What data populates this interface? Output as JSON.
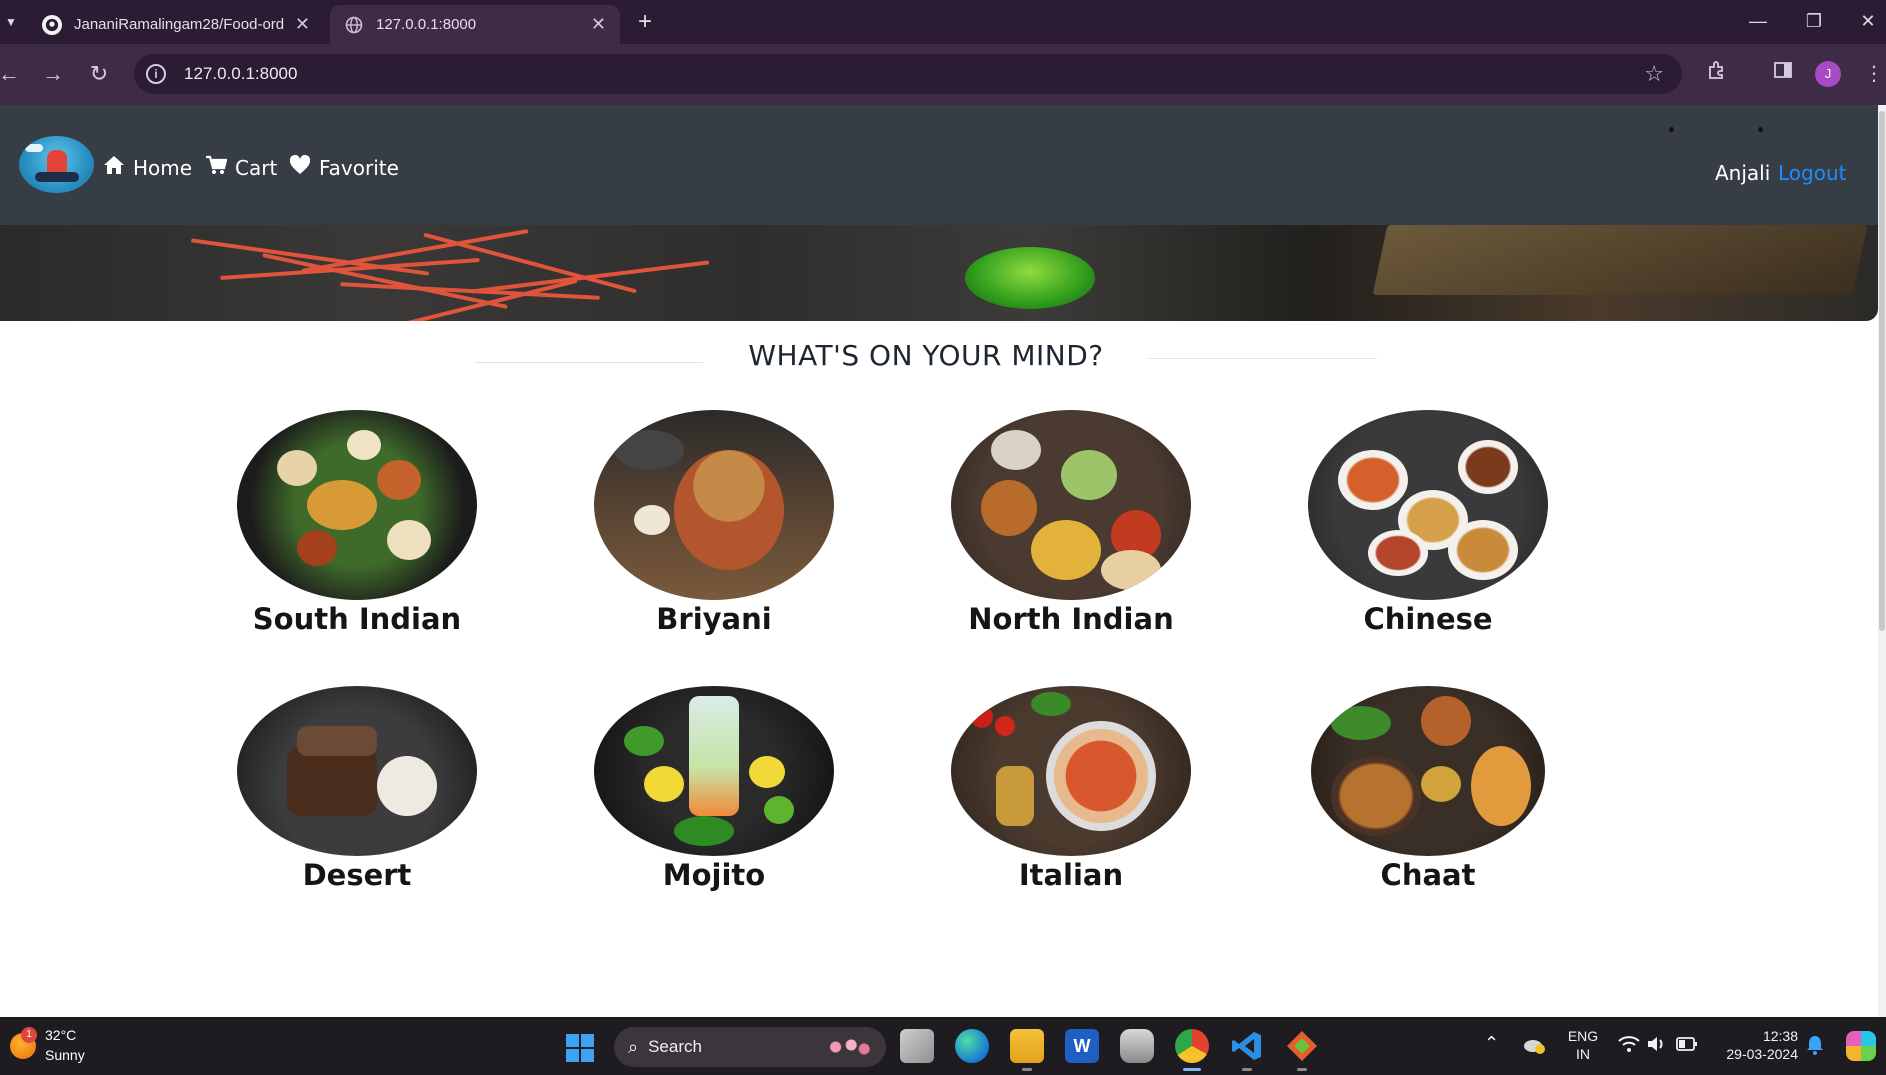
{
  "browser": {
    "tabs": [
      {
        "title": "JananiRamalingam28/Food-ord",
        "active": false
      },
      {
        "title": "127.0.0.1:8000",
        "active": true
      }
    ],
    "url": "127.0.0.1:8000",
    "profile_initial": "J"
  },
  "navbar": {
    "links": [
      {
        "label": "Home",
        "icon": "home-icon"
      },
      {
        "label": "Cart",
        "icon": "cart-icon"
      },
      {
        "label": "Favorite",
        "icon": "heart-icon"
      }
    ],
    "user": "Anjali",
    "logout": "Logout"
  },
  "heading": "WHAT'S ON YOUR MIND?",
  "categories": [
    {
      "label": "South Indian"
    },
    {
      "label": "Briyani"
    },
    {
      "label": "North Indian"
    },
    {
      "label": "Chinese"
    },
    {
      "label": "Desert"
    },
    {
      "label": "Mojito"
    },
    {
      "label": "Italian"
    },
    {
      "label": "Chaat"
    }
  ],
  "taskbar": {
    "weather_temp": "32°C",
    "weather_cond": "Sunny",
    "weather_badge": "1",
    "search_label": "Search",
    "lang_top": "ENG",
    "lang_bottom": "IN",
    "time": "12:38",
    "date": "29-03-2024"
  }
}
